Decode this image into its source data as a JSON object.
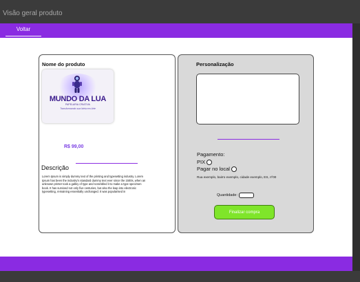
{
  "frame": {
    "title": "Visão geral produto"
  },
  "nav": {
    "back_label": "Voltar"
  },
  "product": {
    "name": "Nome do produto",
    "logo": {
      "title": "MUNDO DA LUA",
      "subtitle": "PAPELARIA CRIATIVA",
      "tagline": "Transformando sua Ideia em Arte"
    },
    "price": "R$ 99,00",
    "description_title": "Descrição",
    "description_text": "Lorem Ipsum is simply dummy text of the printing and typesetting industry. Lorem Ipsum has been the industry's standard dummy text ever since the 1500s, when an unknown printer took a galley of type and scrambled it to make a type specimen book. It has survived not only five centuries, but also the leap into electronic typesetting, remaining essentially unchanged. It was popularised in"
  },
  "customization": {
    "title": "Personalização",
    "textarea_value": "",
    "payment_label": "Pagamento:",
    "payment_options": [
      {
        "label": "PIX"
      },
      {
        "label": "Pagar no local"
      }
    ],
    "address": "Rua exemplo, bairro exemplo, cidade exemplo, ES, nº00",
    "quantity_label": "Quantidade:",
    "quantity_value": "",
    "buy_label": "Finalizar compra"
  },
  "colors": {
    "accent": "#8a2be2",
    "buy_button": "#7fe52a",
    "price": "#7b3fe4",
    "panel_gray": "#d9d9d9"
  }
}
